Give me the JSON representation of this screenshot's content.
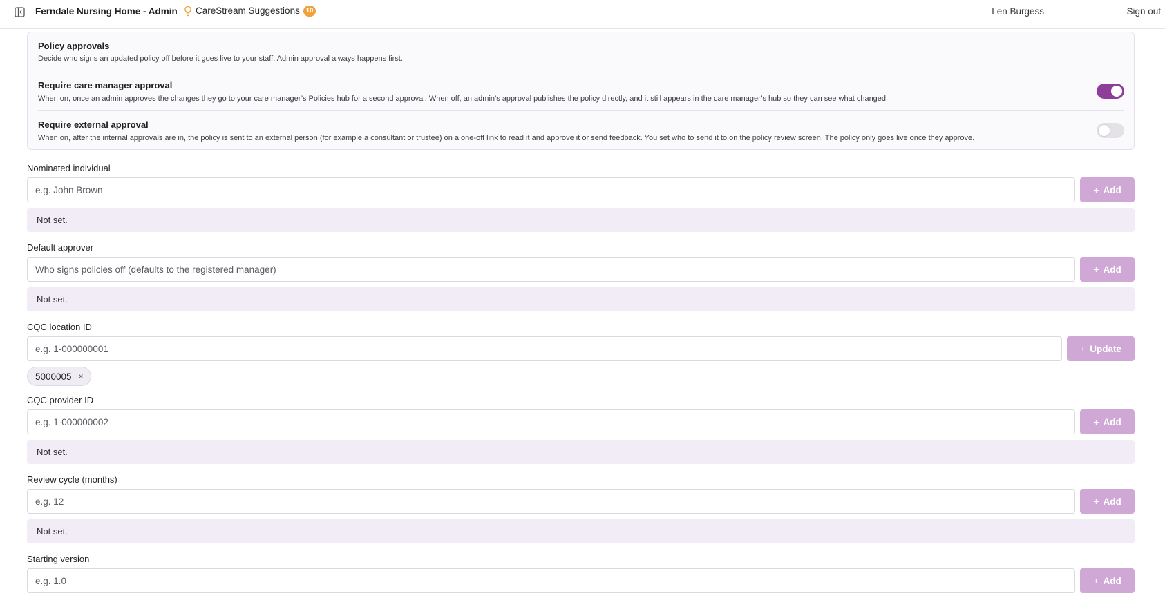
{
  "header": {
    "app_title": "Ferndale Nursing Home - Admin",
    "suggestions_label": "CareStream Suggestions",
    "suggestions_count": "10",
    "user_name": "Len Burgess",
    "sign_out_label": "Sign out"
  },
  "approvals": {
    "title": "Policy approvals",
    "description": "Decide who signs an updated policy off before it goes live to your staff. Admin approval always happens first.",
    "care_manager": {
      "title": "Require care manager approval",
      "description": "When on, once an admin approves the changes they go to your care manager’s Policies hub for a second approval. When off, an admin’s approval publishes the policy directly, and it still appears in the care manager’s hub so they can see what changed.",
      "enabled": true
    },
    "external": {
      "title": "Require external approval",
      "description": "When on, after the internal approvals are in, the policy is sent to an external person (for example a consultant or trustee) on a one-off link to read it and approve it or send feedback. You set who to send it to on the policy review screen. The policy only goes live once they approve.",
      "enabled": false
    }
  },
  "fields": {
    "nominated_individual": {
      "label": "Nominated individual",
      "placeholder": "e.g. John Brown",
      "button": "Add",
      "status": "Not set."
    },
    "default_approver": {
      "label": "Default approver",
      "placeholder": "Who signs policies off (defaults to the registered manager)",
      "button": "Add",
      "status": "Not set."
    },
    "cqc_location_id": {
      "label": "CQC location ID",
      "placeholder": "e.g. 1-000000001",
      "button": "Update",
      "chip_value": "5000005",
      "chip_remove": "×"
    },
    "cqc_provider_id": {
      "label": "CQC provider ID",
      "placeholder": "e.g. 1-000000002",
      "button": "Add",
      "status": "Not set."
    },
    "review_cycle": {
      "label": "Review cycle (months)",
      "placeholder": "e.g. 12",
      "button": "Add",
      "status": "Not set."
    },
    "starting_version": {
      "label": "Starting version",
      "placeholder": "e.g. 1.0",
      "button": "Add"
    }
  },
  "colors": {
    "accent": "#8e3e98",
    "button_disabled": "#cfa8d6",
    "badge": "#f0a23b",
    "status_bg": "#f1ecf6"
  },
  "icons": {
    "sidebar_toggle": "sidebar-toggle-icon",
    "suggestions": "lightbulb-icon",
    "add": "plus-icon",
    "remove": "close-icon"
  }
}
